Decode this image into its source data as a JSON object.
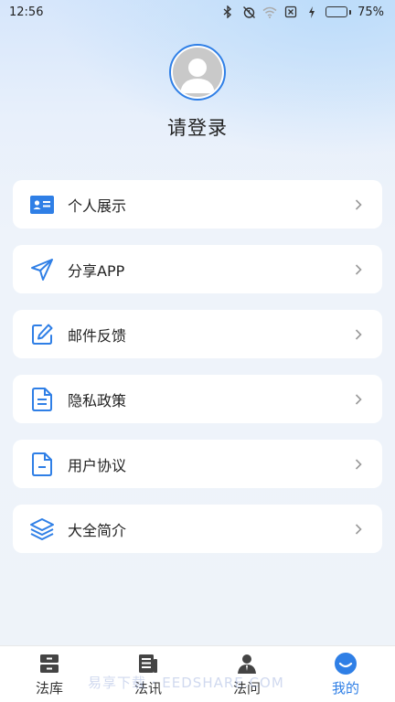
{
  "status_bar": {
    "time": "12:56",
    "battery_percent": "75%",
    "battery_level": 0.75,
    "icons": [
      "bluetooth-icon",
      "alarm-off-icon",
      "wifi-icon",
      "sim-off-icon",
      "charging-icon"
    ]
  },
  "profile": {
    "login_label": "请登录"
  },
  "menu": {
    "items": [
      {
        "label": "个人展示",
        "icon": "id-card-icon"
      },
      {
        "label": "分享APP",
        "icon": "send-icon"
      },
      {
        "label": "邮件反馈",
        "icon": "edit-icon"
      },
      {
        "label": "隐私政策",
        "icon": "document-icon"
      },
      {
        "label": "用户协议",
        "icon": "file-minus-icon"
      },
      {
        "label": "大全简介",
        "icon": "layers-icon"
      }
    ]
  },
  "bottom_nav": {
    "items": [
      {
        "label": "法库",
        "icon": "archive-icon",
        "active": false
      },
      {
        "label": "法讯",
        "icon": "news-icon",
        "active": false
      },
      {
        "label": "法问",
        "icon": "person-icon",
        "active": false
      },
      {
        "label": "我的",
        "icon": "my-icon",
        "active": true
      }
    ]
  },
  "watermark": "易享下载 · EEDSHARE.COM",
  "colors": {
    "accent": "#2f7fe6",
    "battery": "#4caf50",
    "card": "#ffffff"
  }
}
